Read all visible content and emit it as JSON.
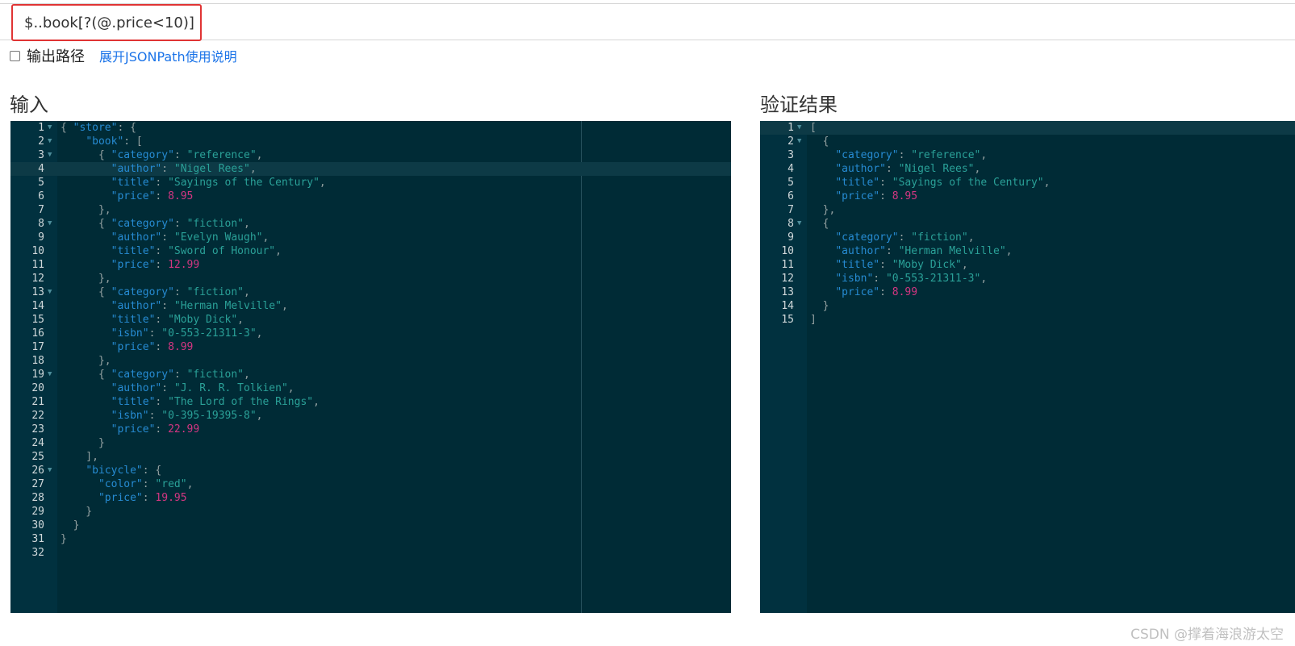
{
  "query": {
    "value": "$..book[?(@.price<10)]"
  },
  "options": {
    "output_path_label": "输出路径",
    "output_path_checked": false,
    "toggle_help_link": "展开JSONPath使用说明"
  },
  "panels": {
    "input_title": "输入",
    "result_title": "验证结果"
  },
  "input_editor": {
    "active_line": 4,
    "lines": [
      {
        "n": "1",
        "fold": true,
        "t": [
          [
            "p",
            "{ "
          ],
          [
            "k",
            "\"store\""
          ],
          [
            "p",
            ": {"
          ]
        ]
      },
      {
        "n": "2",
        "fold": true,
        "t": [
          [
            "p",
            "    "
          ],
          [
            "k",
            "\"book\""
          ],
          [
            "p",
            ": ["
          ]
        ]
      },
      {
        "n": "3",
        "fold": true,
        "t": [
          [
            "p",
            "      { "
          ],
          [
            "k",
            "\"category\""
          ],
          [
            "p",
            ": "
          ],
          [
            "s",
            "\"reference\""
          ],
          [
            "p",
            ","
          ]
        ]
      },
      {
        "n": "4",
        "t": [
          [
            "p",
            "        "
          ],
          [
            "k",
            "\"author\""
          ],
          [
            "p",
            ": "
          ],
          [
            "s",
            "\"Nigel Rees\""
          ],
          [
            "p",
            ","
          ]
        ]
      },
      {
        "n": "5",
        "t": [
          [
            "p",
            "        "
          ],
          [
            "k",
            "\"title\""
          ],
          [
            "p",
            ": "
          ],
          [
            "s",
            "\"Sayings of the Century\""
          ],
          [
            "p",
            ","
          ]
        ]
      },
      {
        "n": "6",
        "t": [
          [
            "p",
            "        "
          ],
          [
            "k",
            "\"price\""
          ],
          [
            "p",
            ": "
          ],
          [
            "n",
            "8.95"
          ]
        ]
      },
      {
        "n": "7",
        "t": [
          [
            "p",
            "      },"
          ]
        ]
      },
      {
        "n": "8",
        "fold": true,
        "t": [
          [
            "p",
            "      { "
          ],
          [
            "k",
            "\"category\""
          ],
          [
            "p",
            ": "
          ],
          [
            "s",
            "\"fiction\""
          ],
          [
            "p",
            ","
          ]
        ]
      },
      {
        "n": "9",
        "t": [
          [
            "p",
            "        "
          ],
          [
            "k",
            "\"author\""
          ],
          [
            "p",
            ": "
          ],
          [
            "s",
            "\"Evelyn Waugh\""
          ],
          [
            "p",
            ","
          ]
        ]
      },
      {
        "n": "10",
        "t": [
          [
            "p",
            "        "
          ],
          [
            "k",
            "\"title\""
          ],
          [
            "p",
            ": "
          ],
          [
            "s",
            "\"Sword of Honour\""
          ],
          [
            "p",
            ","
          ]
        ]
      },
      {
        "n": "11",
        "t": [
          [
            "p",
            "        "
          ],
          [
            "k",
            "\"price\""
          ],
          [
            "p",
            ": "
          ],
          [
            "n",
            "12.99"
          ]
        ]
      },
      {
        "n": "12",
        "t": [
          [
            "p",
            "      },"
          ]
        ]
      },
      {
        "n": "13",
        "fold": true,
        "t": [
          [
            "p",
            "      { "
          ],
          [
            "k",
            "\"category\""
          ],
          [
            "p",
            ": "
          ],
          [
            "s",
            "\"fiction\""
          ],
          [
            "p",
            ","
          ]
        ]
      },
      {
        "n": "14",
        "t": [
          [
            "p",
            "        "
          ],
          [
            "k",
            "\"author\""
          ],
          [
            "p",
            ": "
          ],
          [
            "s",
            "\"Herman Melville\""
          ],
          [
            "p",
            ","
          ]
        ]
      },
      {
        "n": "15",
        "t": [
          [
            "p",
            "        "
          ],
          [
            "k",
            "\"title\""
          ],
          [
            "p",
            ": "
          ],
          [
            "s",
            "\"Moby Dick\""
          ],
          [
            "p",
            ","
          ]
        ]
      },
      {
        "n": "16",
        "t": [
          [
            "p",
            "        "
          ],
          [
            "k",
            "\"isbn\""
          ],
          [
            "p",
            ": "
          ],
          [
            "s",
            "\"0-553-21311-3\""
          ],
          [
            "p",
            ","
          ]
        ]
      },
      {
        "n": "17",
        "t": [
          [
            "p",
            "        "
          ],
          [
            "k",
            "\"price\""
          ],
          [
            "p",
            ": "
          ],
          [
            "n",
            "8.99"
          ]
        ]
      },
      {
        "n": "18",
        "t": [
          [
            "p",
            "      },"
          ]
        ]
      },
      {
        "n": "19",
        "fold": true,
        "t": [
          [
            "p",
            "      { "
          ],
          [
            "k",
            "\"category\""
          ],
          [
            "p",
            ": "
          ],
          [
            "s",
            "\"fiction\""
          ],
          [
            "p",
            ","
          ]
        ]
      },
      {
        "n": "20",
        "t": [
          [
            "p",
            "        "
          ],
          [
            "k",
            "\"author\""
          ],
          [
            "p",
            ": "
          ],
          [
            "s",
            "\"J. R. R. Tolkien\""
          ],
          [
            "p",
            ","
          ]
        ]
      },
      {
        "n": "21",
        "t": [
          [
            "p",
            "        "
          ],
          [
            "k",
            "\"title\""
          ],
          [
            "p",
            ": "
          ],
          [
            "s",
            "\"The Lord of the Rings\""
          ],
          [
            "p",
            ","
          ]
        ]
      },
      {
        "n": "22",
        "t": [
          [
            "p",
            "        "
          ],
          [
            "k",
            "\"isbn\""
          ],
          [
            "p",
            ": "
          ],
          [
            "s",
            "\"0-395-19395-8\""
          ],
          [
            "p",
            ","
          ]
        ]
      },
      {
        "n": "23",
        "t": [
          [
            "p",
            "        "
          ],
          [
            "k",
            "\"price\""
          ],
          [
            "p",
            ": "
          ],
          [
            "n",
            "22.99"
          ]
        ]
      },
      {
        "n": "24",
        "t": [
          [
            "p",
            "      }"
          ]
        ]
      },
      {
        "n": "25",
        "t": [
          [
            "p",
            "    ],"
          ]
        ]
      },
      {
        "n": "26",
        "fold": true,
        "t": [
          [
            "p",
            "    "
          ],
          [
            "k",
            "\"bicycle\""
          ],
          [
            "p",
            ": {"
          ]
        ]
      },
      {
        "n": "27",
        "t": [
          [
            "p",
            "      "
          ],
          [
            "k",
            "\"color\""
          ],
          [
            "p",
            ": "
          ],
          [
            "s",
            "\"red\""
          ],
          [
            "p",
            ","
          ]
        ]
      },
      {
        "n": "28",
        "t": [
          [
            "p",
            "      "
          ],
          [
            "k",
            "\"price\""
          ],
          [
            "p",
            ": "
          ],
          [
            "n",
            "19.95"
          ]
        ]
      },
      {
        "n": "29",
        "t": [
          [
            "p",
            "    }"
          ]
        ]
      },
      {
        "n": "30",
        "t": [
          [
            "p",
            "  }"
          ]
        ]
      },
      {
        "n": "31",
        "t": [
          [
            "p",
            "}"
          ]
        ]
      },
      {
        "n": "32",
        "t": []
      }
    ]
  },
  "result_editor": {
    "active_line": 1,
    "lines": [
      {
        "n": "1",
        "fold": true,
        "t": [
          [
            "p",
            "["
          ]
        ]
      },
      {
        "n": "2",
        "fold": true,
        "t": [
          [
            "p",
            "  {"
          ]
        ]
      },
      {
        "n": "3",
        "t": [
          [
            "p",
            "    "
          ],
          [
            "k",
            "\"category\""
          ],
          [
            "p",
            ": "
          ],
          [
            "s",
            "\"reference\""
          ],
          [
            "p",
            ","
          ]
        ]
      },
      {
        "n": "4",
        "t": [
          [
            "p",
            "    "
          ],
          [
            "k",
            "\"author\""
          ],
          [
            "p",
            ": "
          ],
          [
            "s",
            "\"Nigel Rees\""
          ],
          [
            "p",
            ","
          ]
        ]
      },
      {
        "n": "5",
        "t": [
          [
            "p",
            "    "
          ],
          [
            "k",
            "\"title\""
          ],
          [
            "p",
            ": "
          ],
          [
            "s",
            "\"Sayings of the Century\""
          ],
          [
            "p",
            ","
          ]
        ]
      },
      {
        "n": "6",
        "t": [
          [
            "p",
            "    "
          ],
          [
            "k",
            "\"price\""
          ],
          [
            "p",
            ": "
          ],
          [
            "n",
            "8.95"
          ]
        ]
      },
      {
        "n": "7",
        "t": [
          [
            "p",
            "  },"
          ]
        ]
      },
      {
        "n": "8",
        "fold": true,
        "t": [
          [
            "p",
            "  {"
          ]
        ]
      },
      {
        "n": "9",
        "t": [
          [
            "p",
            "    "
          ],
          [
            "k",
            "\"category\""
          ],
          [
            "p",
            ": "
          ],
          [
            "s",
            "\"fiction\""
          ],
          [
            "p",
            ","
          ]
        ]
      },
      {
        "n": "10",
        "t": [
          [
            "p",
            "    "
          ],
          [
            "k",
            "\"author\""
          ],
          [
            "p",
            ": "
          ],
          [
            "s",
            "\"Herman Melville\""
          ],
          [
            "p",
            ","
          ]
        ]
      },
      {
        "n": "11",
        "t": [
          [
            "p",
            "    "
          ],
          [
            "k",
            "\"title\""
          ],
          [
            "p",
            ": "
          ],
          [
            "s",
            "\"Moby Dick\""
          ],
          [
            "p",
            ","
          ]
        ]
      },
      {
        "n": "12",
        "t": [
          [
            "p",
            "    "
          ],
          [
            "k",
            "\"isbn\""
          ],
          [
            "p",
            ": "
          ],
          [
            "s",
            "\"0-553-21311-3\""
          ],
          [
            "p",
            ","
          ]
        ]
      },
      {
        "n": "13",
        "t": [
          [
            "p",
            "    "
          ],
          [
            "k",
            "\"price\""
          ],
          [
            "p",
            ": "
          ],
          [
            "n",
            "8.99"
          ]
        ]
      },
      {
        "n": "14",
        "t": [
          [
            "p",
            "  }"
          ]
        ]
      },
      {
        "n": "15",
        "t": [
          [
            "p",
            "]"
          ]
        ]
      }
    ]
  },
  "watermark": "CSDN @撑着海浪游太空"
}
